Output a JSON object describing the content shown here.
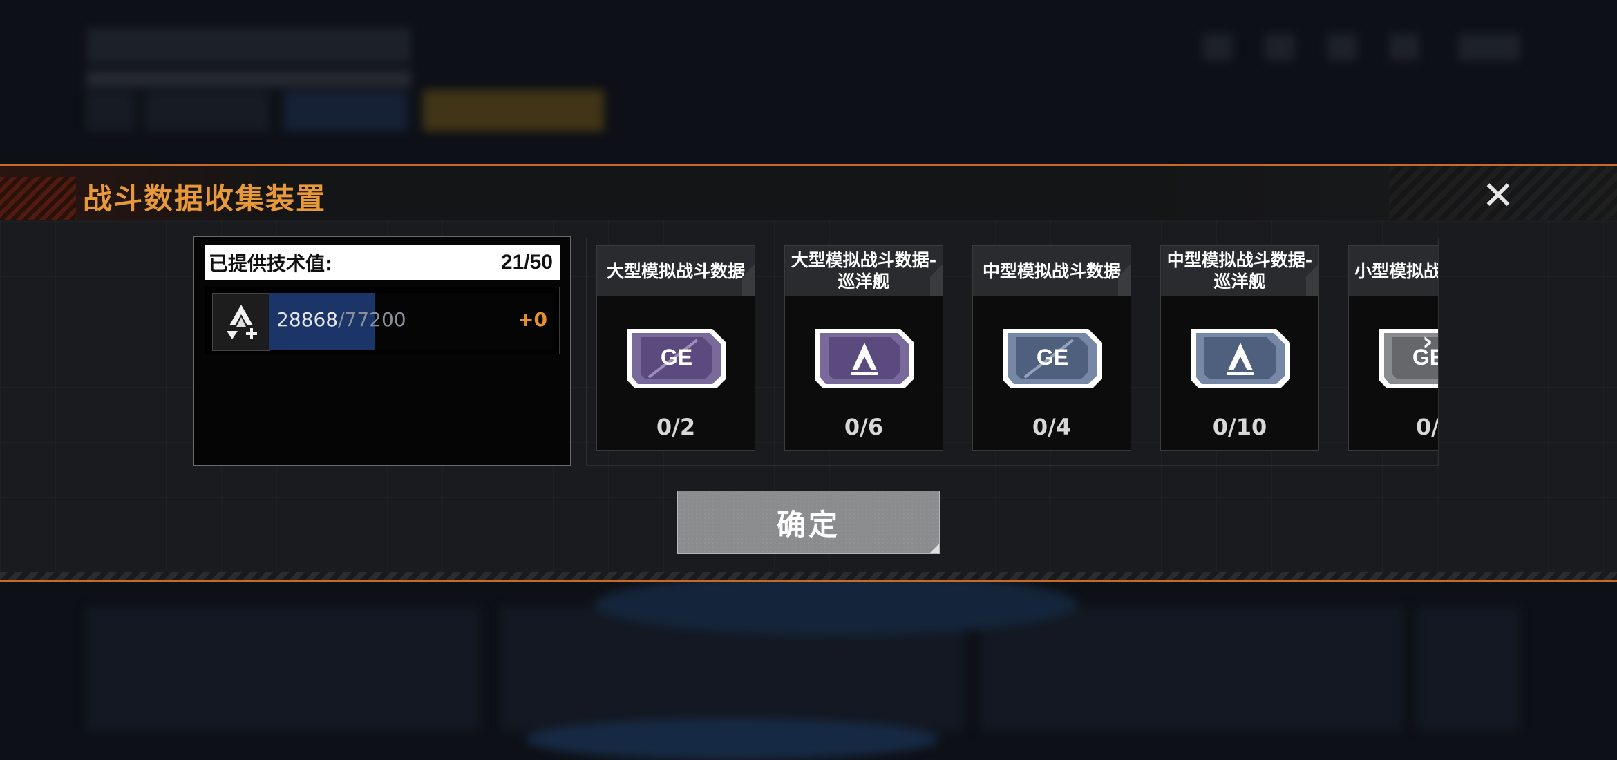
{
  "modal": {
    "title": "战斗数据收集装置",
    "close_icon": "close-icon",
    "accent_color": "#e89a3a"
  },
  "tech_panel": {
    "label": "已提供技术值:",
    "count": "21/50",
    "icon": "tech-value-icon",
    "current": "28868",
    "separator": "/",
    "max": "77200",
    "fill_fraction": 0.374,
    "plus": "+0"
  },
  "items": [
    {
      "title": "大型模拟战斗数据",
      "count": "0/2",
      "icon": "ge-chip-icon",
      "tier": "large"
    },
    {
      "title": "大型模拟战斗数据-\n巡洋舰",
      "count": "0/6",
      "icon": "cruiser-chip-icon",
      "tier": "large"
    },
    {
      "title": "中型模拟战斗数据",
      "count": "0/4",
      "icon": "ge-chip-icon",
      "tier": "medium"
    },
    {
      "title": "中型模拟战斗数据-\n巡洋舰",
      "count": "0/10",
      "icon": "cruiser-chip-icon",
      "tier": "medium"
    },
    {
      "title": "小型模拟战斗数据",
      "count": "0/",
      "icon": "ge-chip-icon",
      "tier": "small"
    }
  ],
  "scroll_icon": "chevron-right-icon",
  "confirm_label": "确定"
}
